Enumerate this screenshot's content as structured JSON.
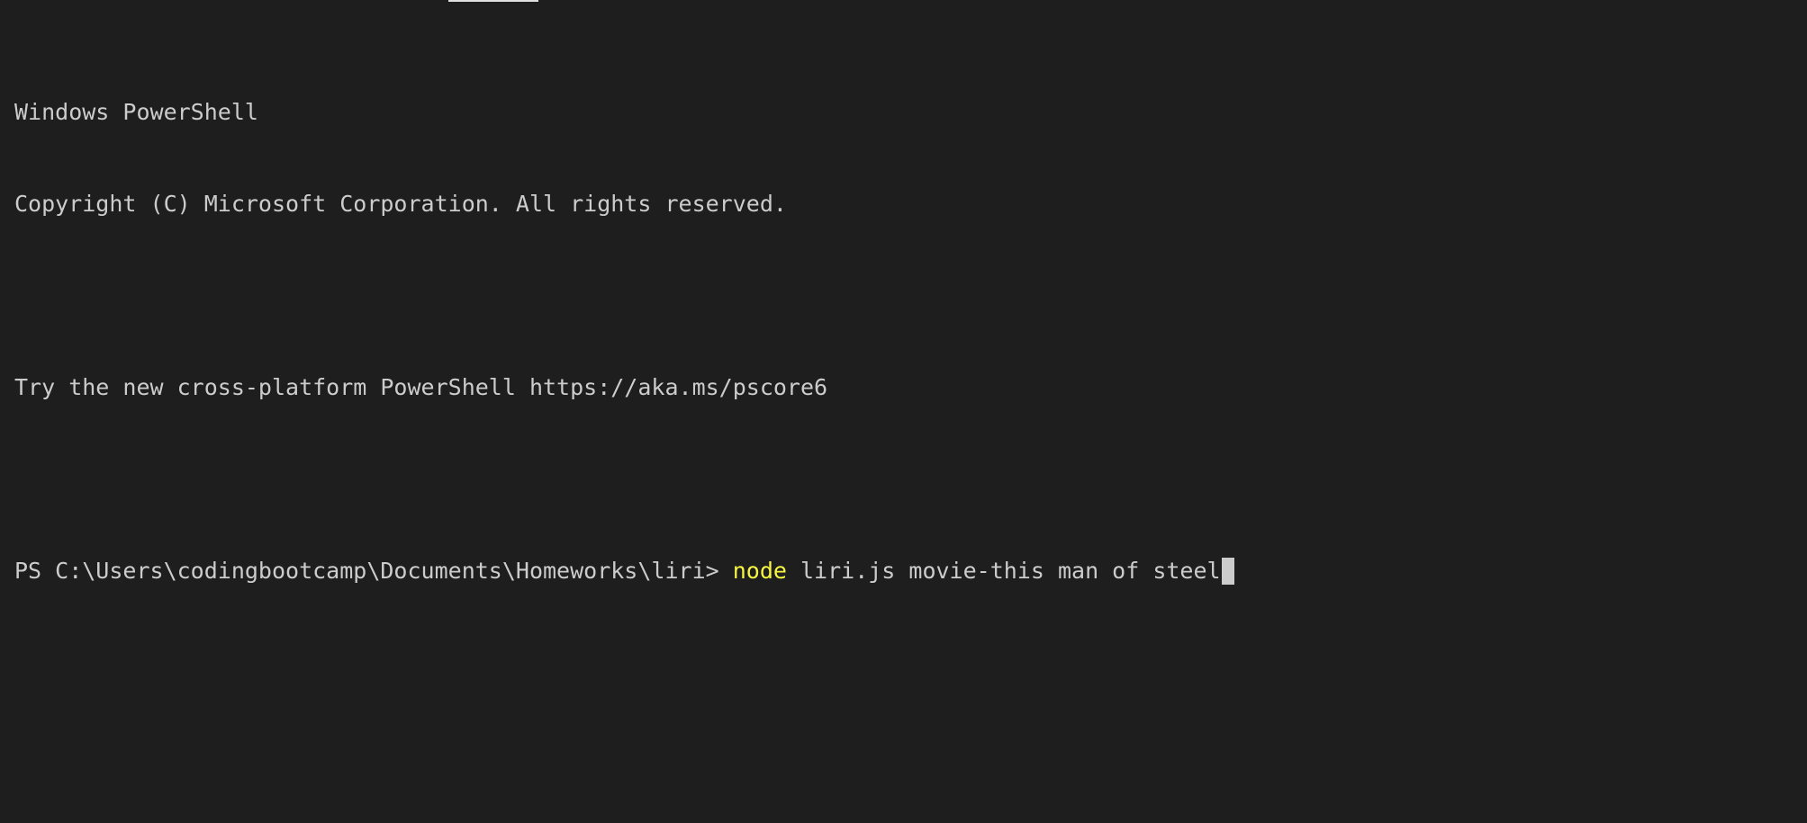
{
  "terminal": {
    "lines": [
      "Windows PowerShell",
      "Copyright (C) Microsoft Corporation. All rights reserved.",
      "",
      "Try the new cross-platform PowerShell https://aka.ms/pscore6",
      ""
    ],
    "prompt": "PS C:\\Users\\codingbootcamp\\Documents\\Homeworks\\liri> ",
    "command_keyword": "node",
    "command_args": " liri.js movie-this man of steel"
  },
  "colors": {
    "background": "#1e1e1e",
    "foreground": "#cccccc",
    "keyword": "#f5f543"
  }
}
